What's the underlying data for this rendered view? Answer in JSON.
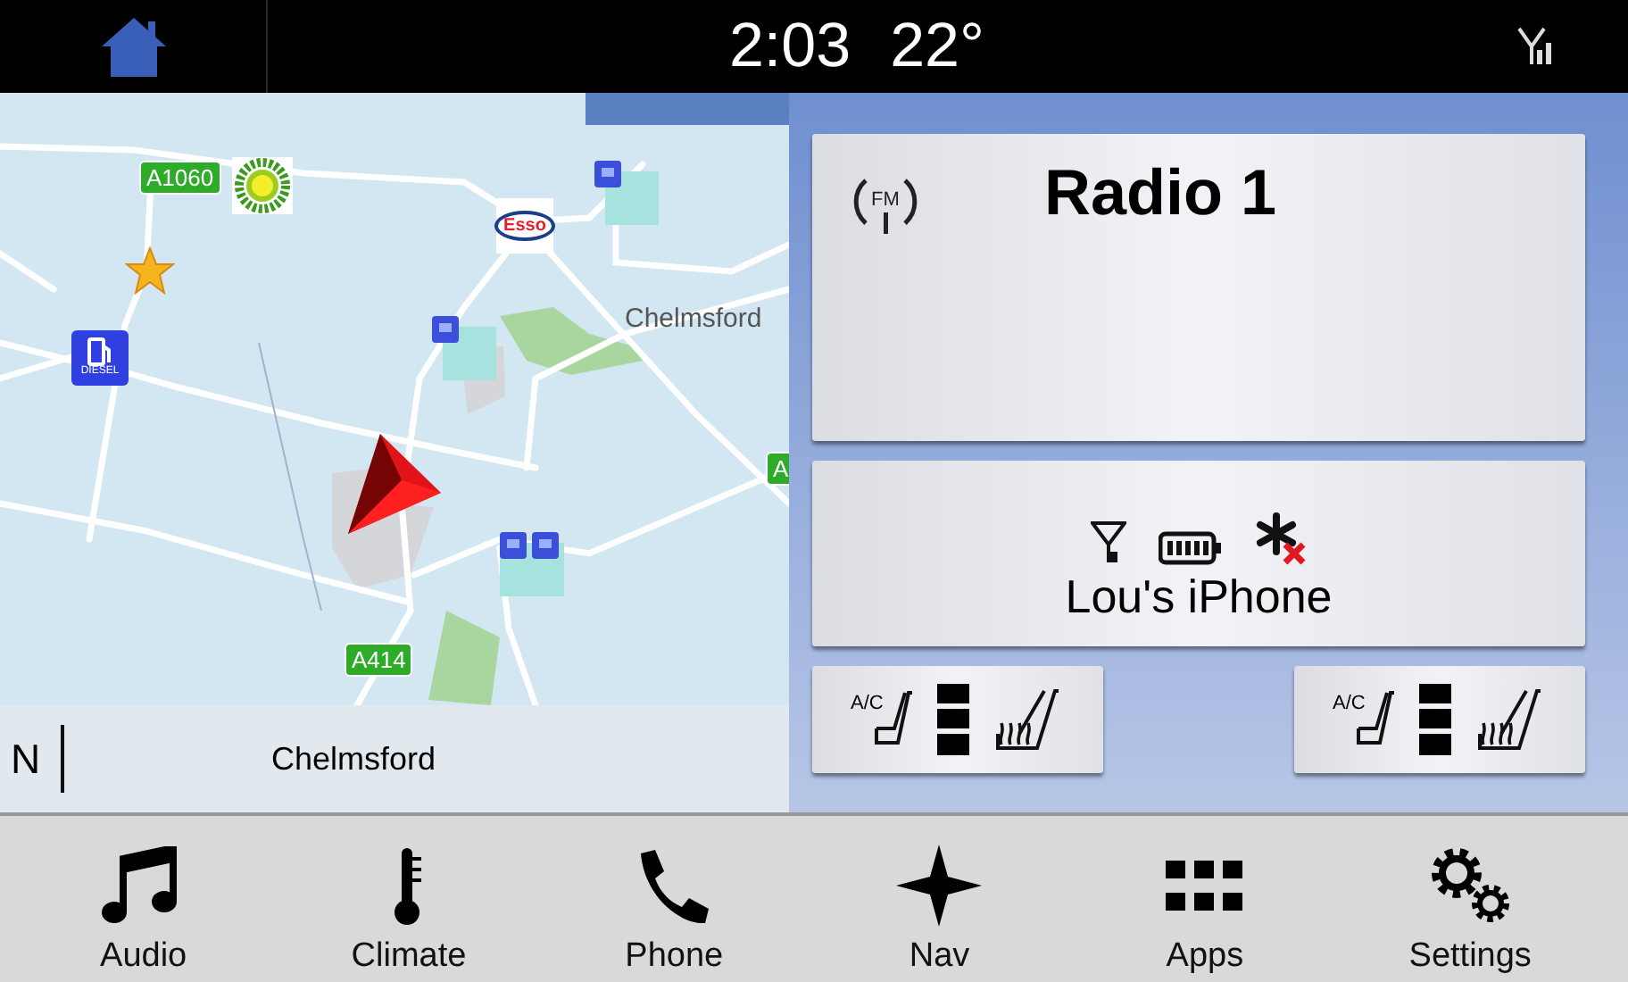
{
  "status_bar": {
    "time": "2:03",
    "temperature": "22°"
  },
  "map": {
    "markers": [
      {
        "kind": "road",
        "text": "A1060"
      },
      {
        "kind": "bp"
      },
      {
        "kind": "star"
      },
      {
        "kind": "diesel",
        "text": "DIESEL"
      },
      {
        "kind": "esso",
        "text": "Esso"
      },
      {
        "kind": "poi"
      },
      {
        "kind": "poi"
      },
      {
        "kind": "poi-pair"
      },
      {
        "kind": "place",
        "text": "Chelmsford"
      },
      {
        "kind": "road",
        "text": "A"
      },
      {
        "kind": "road",
        "text": "A414"
      },
      {
        "kind": "vehicle"
      }
    ],
    "footer": {
      "heading": "N",
      "area": "Chelmsford"
    }
  },
  "radio": {
    "band": "FM",
    "station": "Radio 1"
  },
  "phone": {
    "name": "Lou's iPhone",
    "bluetooth_connected": false
  },
  "seats": [
    {
      "ac_label": "A/C"
    },
    {
      "ac_label": "A/C"
    }
  ],
  "nav": [
    {
      "kind": "audio",
      "label": "Audio"
    },
    {
      "kind": "climate",
      "label": "Climate"
    },
    {
      "kind": "phone",
      "label": "Phone"
    },
    {
      "kind": "nav",
      "label": "Nav"
    },
    {
      "kind": "apps",
      "label": "Apps"
    },
    {
      "kind": "settings",
      "label": "Settings"
    }
  ]
}
